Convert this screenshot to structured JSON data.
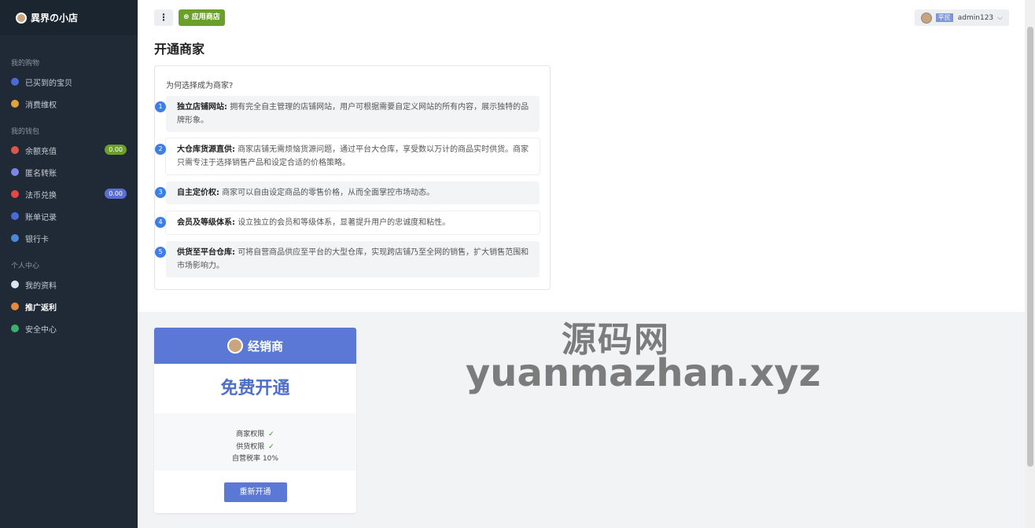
{
  "brand": {
    "name": "異界の小店"
  },
  "sidebar": {
    "sections": [
      {
        "label": "我的购物",
        "items": [
          {
            "label": "已买到的宝贝",
            "icon": "circle-icon",
            "color": "#4a6ad6"
          },
          {
            "label": "消费维权",
            "icon": "shield-icon",
            "color": "#e2a33a"
          }
        ]
      },
      {
        "label": "我的钱包",
        "items": [
          {
            "label": "余额充值",
            "icon": "coin-icon",
            "color": "#d9584a",
            "badge": "0.00",
            "badge_color": "#6aa02a"
          },
          {
            "label": "匿名转账",
            "icon": "transfer-icon",
            "color": "#7b86e6"
          },
          {
            "label": "法币兑换",
            "icon": "exchange-icon",
            "color": "#e54646",
            "badge": "0.00",
            "badge_color": "#5b6ed1"
          },
          {
            "label": "账单记录",
            "icon": "bill-icon",
            "color": "#4a6ad6"
          },
          {
            "label": "银行卡",
            "icon": "card-icon",
            "color": "#4a8ad6"
          }
        ]
      },
      {
        "label": "个人中心",
        "items": [
          {
            "label": "我的资料",
            "icon": "user-icon",
            "color": "#d7e4f5"
          },
          {
            "label": "推广返利",
            "icon": "send-icon",
            "color": "#e58a3a",
            "active": true
          },
          {
            "label": "安全中心",
            "icon": "security-icon",
            "color": "#3ab06a"
          }
        ]
      }
    ]
  },
  "header": {
    "menu_icon": "⋮",
    "app_store_label": "应用商店",
    "user_level": "平民",
    "username": "admin123"
  },
  "main": {
    "page_title": "开通商家",
    "why_title": "为何选择成为商家?",
    "benefits": [
      {
        "num": "1",
        "title": "独立店铺网站:",
        "text": "拥有完全自主管理的店铺网站，用户可根据需要自定义网站的所有内容，展示独特的品牌形象。"
      },
      {
        "num": "2",
        "title": "大仓库货源直供:",
        "text": "商家店铺无需烦恼货源问题，通过平台大仓库，享受数以万计的商品实时供货。商家只需专注于选择销售产品和设定合适的价格策略。"
      },
      {
        "num": "3",
        "title": "自主定价权:",
        "text": "商家可以自由设定商品的零售价格，从而全面掌控市场动态。"
      },
      {
        "num": "4",
        "title": "会员及等级体系:",
        "text": "设立独立的会员和等级体系，显著提升用户的忠诚度和粘性。"
      },
      {
        "num": "5",
        "title": "供货至平台仓库:",
        "text": "可将自营商品供应至平台的大型仓库，实现跨店铺乃至全网的销售，扩大销售范围和市场影响力。"
      }
    ]
  },
  "package": {
    "name": "经销商",
    "price": "免费开通",
    "features": [
      {
        "label": "商家权限",
        "value": "✓",
        "is_check": true
      },
      {
        "label": "供货权限",
        "value": "✓",
        "is_check": true
      },
      {
        "label": "自营税率",
        "value": "10%",
        "is_check": false
      }
    ],
    "button_label": "重新开通"
  },
  "watermark": {
    "line1": "源码网",
    "line2": "yuanmazhan.xyz"
  }
}
